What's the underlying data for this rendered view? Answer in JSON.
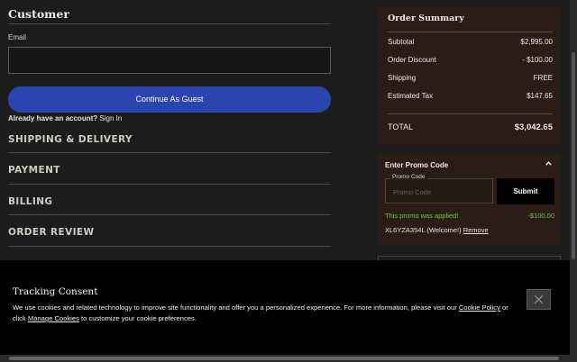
{
  "customer": {
    "title": "Customer",
    "email_label": "Email",
    "email_value": "",
    "guest_button": "Continue As Guest",
    "account_prompt": "Already have an account?",
    "sign_in": "Sign In"
  },
  "sections": [
    "SHIPPING & DELIVERY",
    "PAYMENT",
    "BILLING",
    "ORDER REVIEW"
  ],
  "order_summary": {
    "title": "Order Summary",
    "rows": [
      {
        "label": "Subtotal",
        "value": "$2,995.00"
      },
      {
        "label": "Order Discount",
        "value": "- $100.00"
      },
      {
        "label": "Shipping",
        "value": "FREE"
      },
      {
        "label": "Estimated Tax",
        "value": "$147.65"
      }
    ],
    "total_label": "TOTAL",
    "total_value": "$3,042.65"
  },
  "promo": {
    "title": "Enter Promo Code",
    "field_label": "Promo Code",
    "placeholder": "Promo Code",
    "submit": "Submit",
    "applied_text": "This promo was applied!",
    "applied_amount": "-$100.00",
    "code": "XL6YZA354L (Welcome!)",
    "remove": "Remove"
  },
  "consent": {
    "title": "Tracking Consent",
    "text_1": "We use cookies and related technology to improve site functionality and offer you a personalized experience. For more information, please visit our",
    "cookie_policy": "Cookie Policy",
    "text_2": "or click",
    "manage_cookies": "Manage Cookies",
    "text_3": "to customize your cookie preferences."
  },
  "colors": {
    "accent_button": "#2a44b0",
    "summary_bg": "#2b1d15",
    "promo_applied": "#7bc24a",
    "page_bg": "#1c1c1c"
  }
}
